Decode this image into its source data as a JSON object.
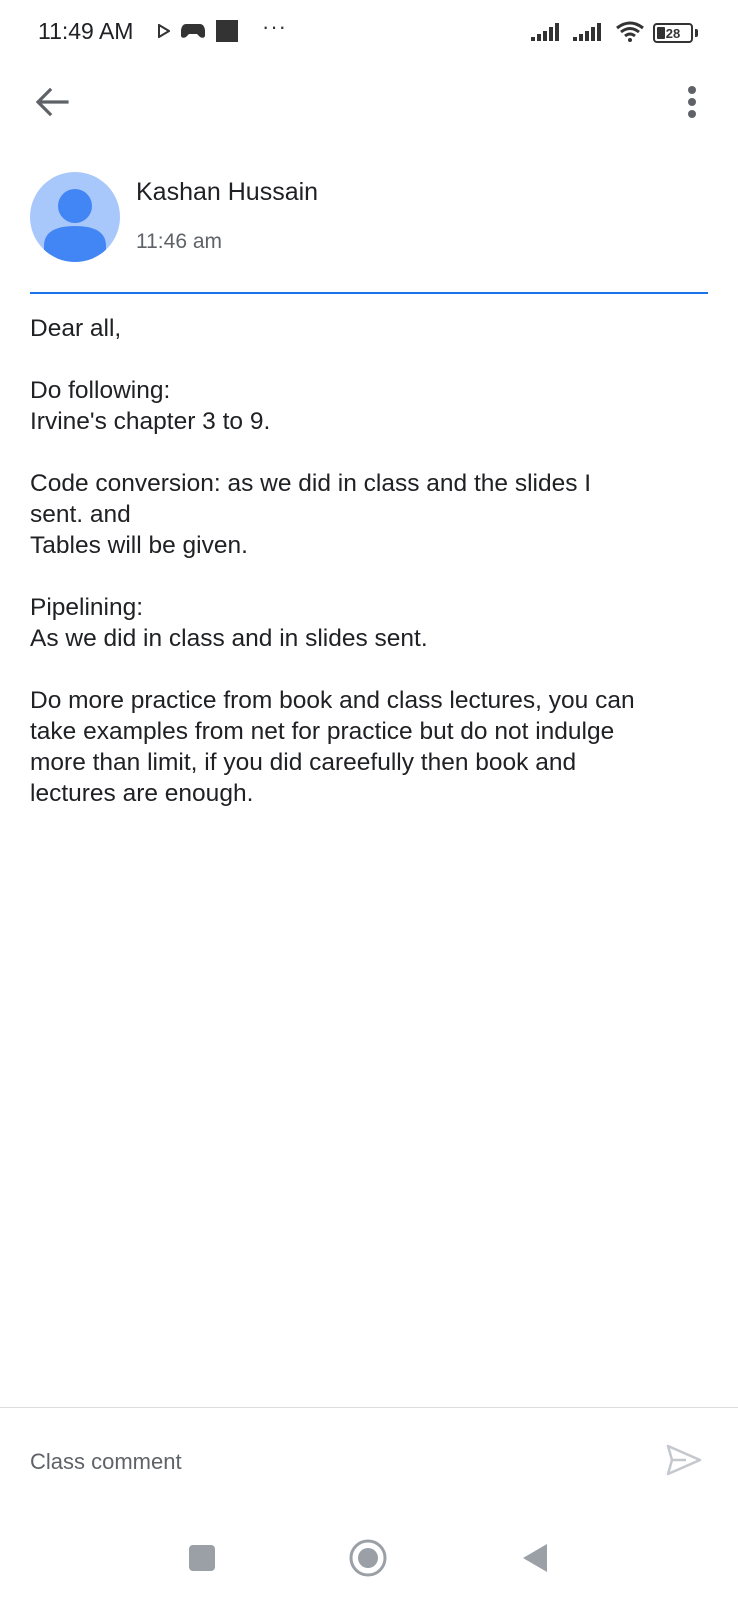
{
  "status_bar": {
    "time": "11:49 AM",
    "battery_level": "28",
    "icons": [
      "play-icon",
      "game-controller-icon",
      "app-square-icon",
      "more-notifications-icon",
      "signal-icon",
      "signal-icon",
      "wifi-icon",
      "battery-icon"
    ]
  },
  "app_bar": {
    "back_icon": "arrow-back-icon",
    "more_icon": "more-vert-icon"
  },
  "post": {
    "author": "Kashan Hussain",
    "time": "11:46 am",
    "paragraphs": [
      [
        "Dear all,"
      ],
      [
        "Do following:",
        "Irvine's chapter 3 to 9."
      ],
      [
        "Code conversion: as we did in class and the slides I",
        "sent. and",
        "Tables will be given."
      ],
      [
        "Pipelining:",
        "As we did in class and in slides sent."
      ],
      [
        "Do more practice from book and class lectures, you can",
        "take examples from net for practice but do not indulge",
        "more than limit, if you did careefully then book and",
        "lectures are enough."
      ]
    ]
  },
  "comment": {
    "placeholder": "Class comment",
    "send_icon": "send-icon"
  },
  "nav_bar": {
    "icons": [
      "recents-square-icon",
      "home-circle-icon",
      "back-triangle-icon"
    ]
  },
  "colors": {
    "accent": "#1a73e8",
    "avatar_bg": "#a8c7fa",
    "avatar_fg": "#4285f4",
    "muted_text": "#5f6368"
  }
}
